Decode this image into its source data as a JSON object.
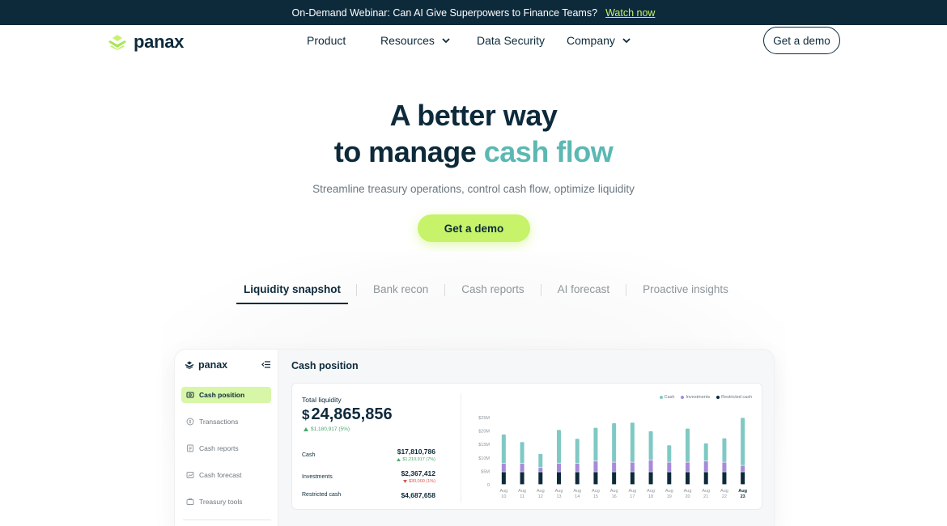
{
  "banner": {
    "text": "On-Demand Webinar: Can AI Give Superpowers to Finance Teams?",
    "link": "Watch now"
  },
  "brand": {
    "name": "panax",
    "accent": "#c6f36a",
    "dark": "#0d2a3b",
    "teal": "#5bb8b3"
  },
  "nav": {
    "items": [
      {
        "label": "Product",
        "dropdown": false
      },
      {
        "label": "Resources",
        "dropdown": true
      },
      {
        "label": "Data Security",
        "dropdown": false
      },
      {
        "label": "Company",
        "dropdown": true
      }
    ],
    "cta": "Get a demo"
  },
  "hero": {
    "line1": "A better way",
    "line2_prefix": "to manage ",
    "line2_accent": "cash flow",
    "subtitle": "Streamline treasury operations, control cash flow, optimize liquidity",
    "cta": "Get a demo"
  },
  "tabs": [
    "Liquidity snapshot",
    "Bank recon",
    "Cash reports",
    "AI forecast",
    "Proactive insights"
  ],
  "active_tab": "Liquidity snapshot",
  "app": {
    "logo": "panax",
    "sidebar": [
      {
        "label": "Cash position",
        "icon": "cash-position-icon",
        "active": true
      },
      {
        "label": "Transactions",
        "icon": "transactions-icon",
        "active": false
      },
      {
        "label": "Cash reports",
        "icon": "cash-reports-icon",
        "active": false
      },
      {
        "label": "Cash forecast",
        "icon": "cash-forecast-icon",
        "active": false
      },
      {
        "label": "Treasury tools",
        "icon": "treasury-tools-icon",
        "active": false
      }
    ],
    "title": "Cash position",
    "total": {
      "label": "Total liquidity",
      "currency": "$",
      "value": "24,865,856",
      "delta": "$1,180,917 (5%)",
      "delta_direction": "up"
    },
    "breakdown": [
      {
        "label": "Cash",
        "value": "$17,810,786",
        "delta": "$1,210,917 (7%)",
        "direction": "up"
      },
      {
        "label": "Investments",
        "value": "$2,367,412",
        "delta": "$30,000 (1%)",
        "direction": "down"
      },
      {
        "label": "Restricted cash",
        "value": "$4,687,658",
        "delta": "",
        "direction": ""
      }
    ]
  },
  "chart_data": {
    "type": "bar",
    "stacked": true,
    "legend_position": "top-right",
    "categories": [
      "Aug 10",
      "Aug 11",
      "Aug 12",
      "Aug 13",
      "Aug 14",
      "Aug 15",
      "Aug 16",
      "Aug 17",
      "Aug 18",
      "Aug 19",
      "Aug 20",
      "Aug 21",
      "Aug 22",
      "Aug 23"
    ],
    "highlight_category": "Aug 23",
    "y_ticks": [
      "0",
      "$5M",
      "$10M",
      "$15M",
      "$20M",
      "$25M"
    ],
    "ylim": [
      0,
      25
    ],
    "series": [
      {
        "name": "Restricted cash",
        "color": "#0d2a3b",
        "values": [
          4.7,
          4.7,
          4.7,
          4.7,
          4.7,
          4.7,
          4.7,
          4.7,
          4.7,
          4.7,
          4.7,
          4.7,
          4.7,
          4.7
        ]
      },
      {
        "name": "Investments",
        "color": "#a78bdb",
        "values": [
          3.2,
          3.2,
          1.6,
          3.2,
          3.2,
          4.0,
          3.6,
          3.6,
          4.4,
          3.6,
          3.6,
          4.0,
          3.6,
          2.4
        ]
      },
      {
        "name": "Cash",
        "color": "#7fc9c4",
        "values": [
          10.8,
          8.0,
          5.2,
          12.5,
          9.2,
          12.5,
          14.6,
          14.8,
          10.8,
          6.4,
          12.6,
          6.7,
          9.0,
          17.8
        ]
      }
    ],
    "legend": [
      "Cash",
      "Investments",
      "Restricted cash"
    ]
  }
}
